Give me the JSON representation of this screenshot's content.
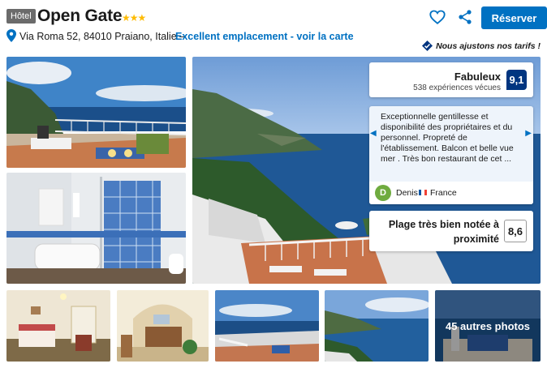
{
  "header": {
    "type_badge": "Hôtel",
    "hotel_name": "Open Gate",
    "stars": "★★★",
    "star_rating": 3,
    "reserve_label": "Réserver",
    "accent_color": "#0071c2"
  },
  "address": {
    "text": "Via Roma 52, 84010 Praiano, Italie –",
    "location_link": "Excellent emplacement - voir la carte"
  },
  "price_note": "Nous ajustons nos tarifs !",
  "score": {
    "label": "Fabuleux",
    "count": "538 expériences vécues",
    "value": "9,1",
    "color": "#003580"
  },
  "review": {
    "text": "Exceptionnelle gentillesse et disponibilité des propriétaires et du personnel. Propreté de l'établissement. Balcon et belle vue mer . Très bon restaurant de cet ...",
    "reviewer_initial": "D",
    "reviewer_name": "Denis",
    "reviewer_country": "France"
  },
  "beach": {
    "label": "Plage très bien notée à proximité",
    "score": "8,6"
  },
  "gallery": {
    "more_photos": "45 autres photos"
  }
}
